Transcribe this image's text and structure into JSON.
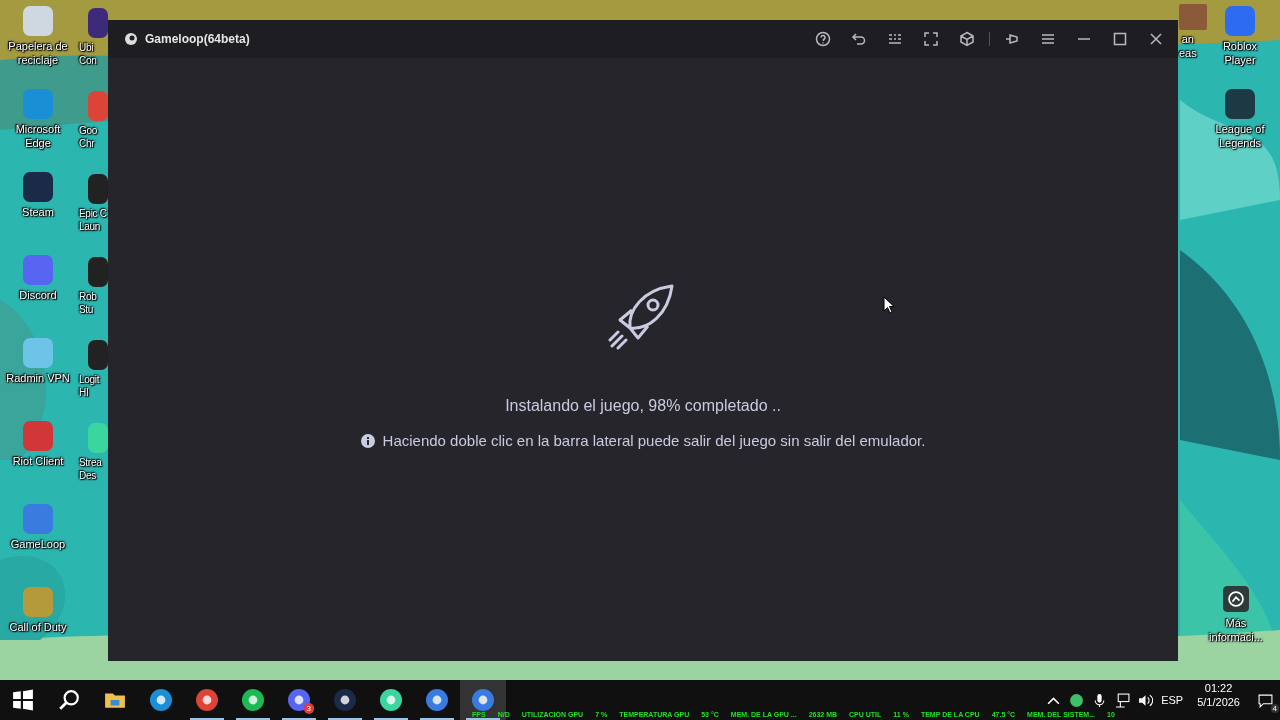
{
  "desktop_left": [
    {
      "label": "Papelera de\nreciclaje",
      "kind": "recycle"
    },
    {
      "label": "Microsoft\nEdge",
      "kind": "edge"
    },
    {
      "label": "Steam",
      "kind": "steam"
    },
    {
      "label": "Discord",
      "kind": "discord"
    },
    {
      "label": "Radmin VPN",
      "kind": "radmin"
    },
    {
      "label": "Riot Client",
      "kind": "riot"
    },
    {
      "label": "GameLoop",
      "kind": "gameloop"
    },
    {
      "label": "Call of Duty",
      "kind": "cod"
    }
  ],
  "desktop_left_partial": [
    {
      "label": "Ubi\nCon",
      "kind": "ubi"
    },
    {
      "label": "Goo\nChr",
      "kind": "chrome"
    },
    {
      "label": "Epic C\nLaun",
      "kind": "epic"
    },
    {
      "label": "Rob\nStu",
      "kind": "robstudio"
    },
    {
      "label": "Logit\nHI",
      "kind": "logi"
    },
    {
      "label": "Strea\nDes",
      "kind": "stream"
    }
  ],
  "desktop_right": [
    {
      "label": "Roblox\nPlayer",
      "kind": "roblox"
    },
    {
      "label": "League of\nLegends",
      "kind": "lol"
    }
  ],
  "desktop_right_partial": {
    "label": "an\neas",
    "kind": "portrait"
  },
  "widget": {
    "label": "Más\ninformaci..."
  },
  "window": {
    "title": "Gameloop(64beta)",
    "status": "Instalando el juego, 98% completado ..",
    "hint": "Haciendo doble clic en la barra lateral puede salir del juego sin salir del emulador."
  },
  "taskbar": {
    "apps": [
      {
        "kind": "start",
        "running": false,
        "selected": false
      },
      {
        "kind": "search",
        "running": false,
        "selected": false
      },
      {
        "kind": "folder",
        "running": false,
        "selected": false
      },
      {
        "kind": "edge",
        "running": false,
        "selected": false
      },
      {
        "kind": "chrome",
        "running": true,
        "selected": false
      },
      {
        "kind": "spotify",
        "running": true,
        "selected": false
      },
      {
        "kind": "discord",
        "running": true,
        "selected": false,
        "badge": "3"
      },
      {
        "kind": "steam",
        "running": true,
        "selected": false
      },
      {
        "kind": "stream",
        "running": true,
        "selected": false
      },
      {
        "kind": "gameloop",
        "running": true,
        "selected": false
      },
      {
        "kind": "gameloop",
        "running": true,
        "selected": true
      }
    ],
    "overlay": [
      "FPS",
      "N/D",
      "UTILIZACIÓN GPU",
      "7 %",
      "TEMPERATURA GPU",
      "53 °C",
      "MEM. DE LA GPU ...",
      "2632 MB",
      "CPU UTIL",
      "11 %",
      "TEMP DE LA CPU",
      "47.5 °C",
      "MEM. DEL SISTEM...",
      "10"
    ],
    "language": "ESP",
    "time": "01:22",
    "date": "5/1/2026",
    "notifications": "4"
  }
}
